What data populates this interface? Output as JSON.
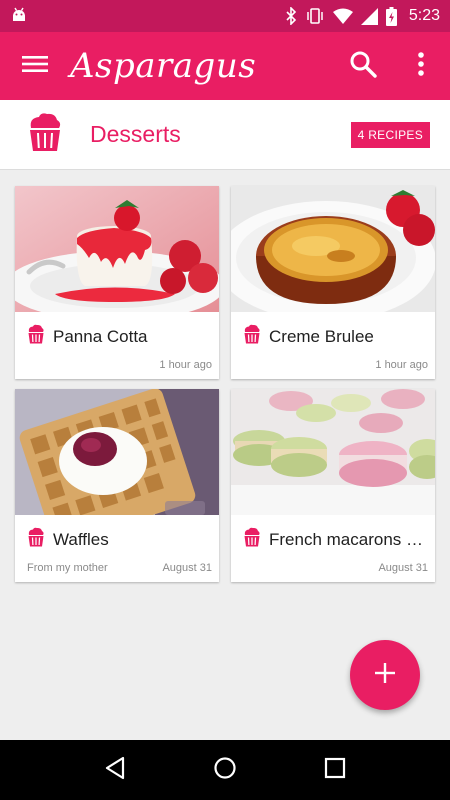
{
  "status_bar": {
    "time": "5:23",
    "icons": [
      "android-debug-icon",
      "bluetooth-icon",
      "vibrate-icon",
      "wifi-icon",
      "signal-icon",
      "battery-charging-icon"
    ]
  },
  "app_bar": {
    "title": "Asparagus",
    "icons": [
      "menu-icon",
      "search-icon",
      "more-vert-icon"
    ]
  },
  "category": {
    "title": "Desserts",
    "badge": "4 RECIPES",
    "icon": "cupcake-icon"
  },
  "recipes": [
    {
      "title": "Panna Cotta",
      "subtitle": "",
      "time": "1 hour ago",
      "image": "panna-cotta-image"
    },
    {
      "title": "Creme Brulee",
      "subtitle": "",
      "time": "1 hour ago",
      "image": "creme-brulee-image"
    },
    {
      "title": "Waffles",
      "subtitle": "From my mother",
      "time": "August 31",
      "image": "waffles-image"
    },
    {
      "title": "French macarons wit…",
      "subtitle": "",
      "time": "August 31",
      "image": "macarons-image"
    }
  ],
  "colors": {
    "primary": "#e91e63",
    "primary_dark": "#c2185b",
    "background": "#eeeeee"
  },
  "fab": {
    "icon": "plus-icon"
  },
  "nav_bar": {
    "icons": [
      "back-icon",
      "home-icon",
      "recents-icon"
    ]
  }
}
